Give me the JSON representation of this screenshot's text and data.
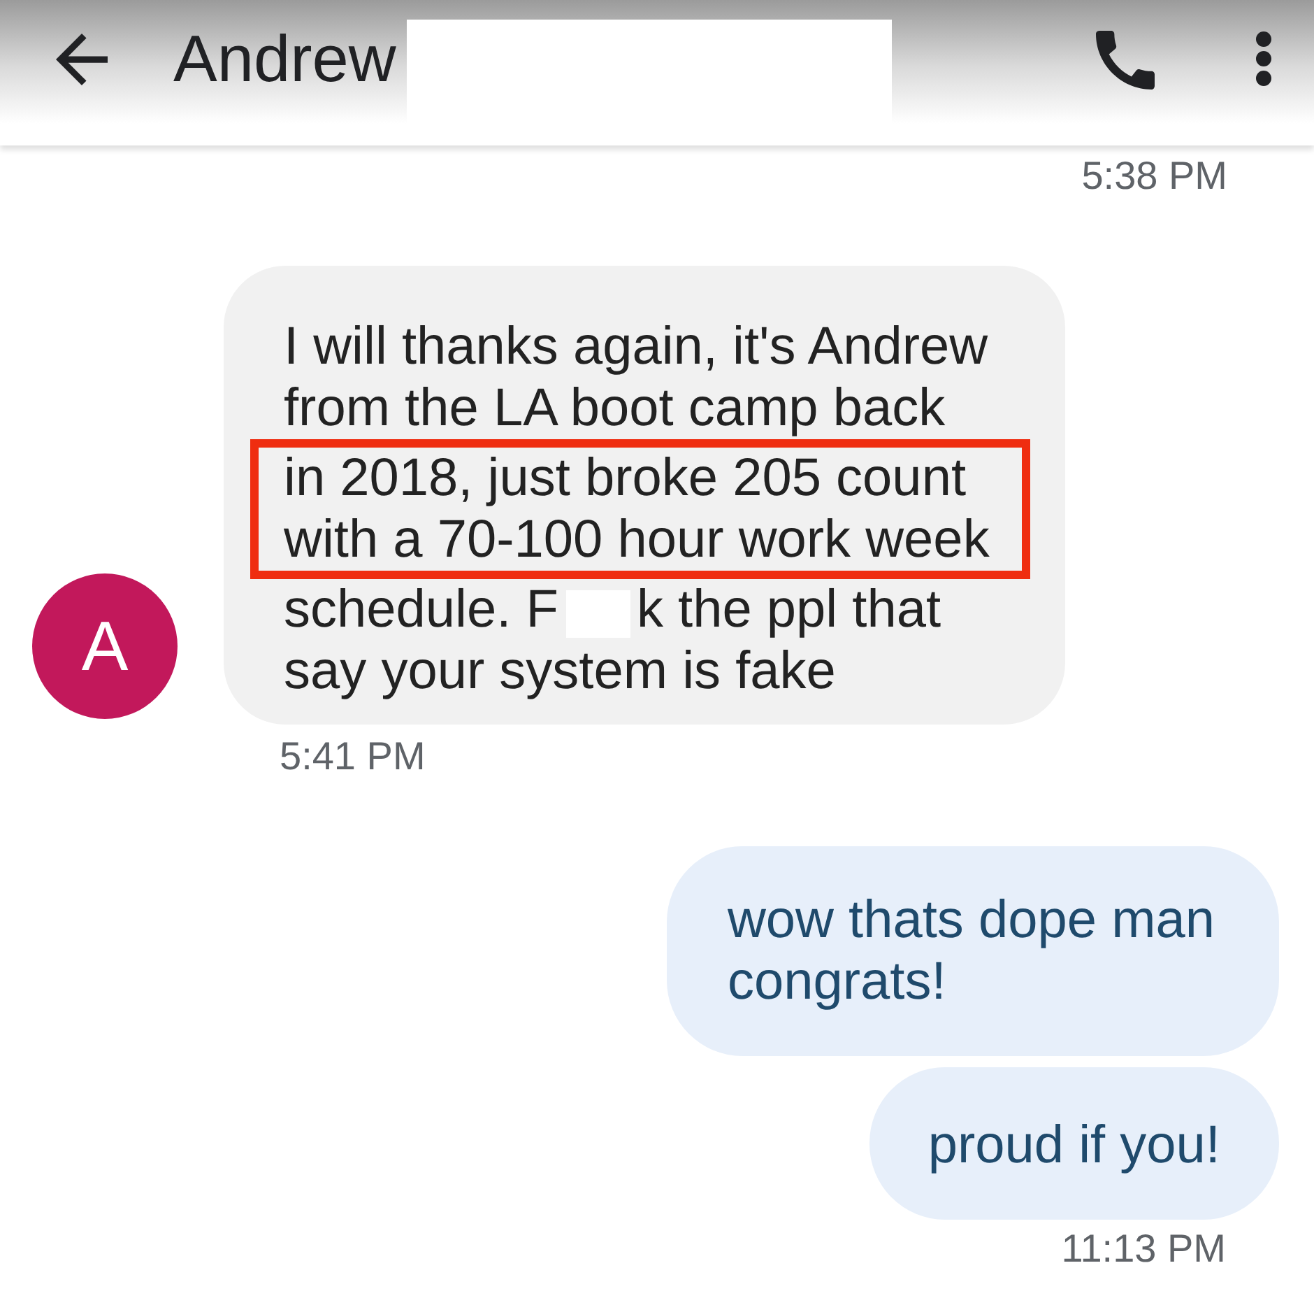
{
  "header": {
    "title": "Andrew",
    "title_redacted": true
  },
  "conversation": [
    {
      "kind": "timestamp",
      "text": "5:38 PM"
    },
    {
      "kind": "incoming",
      "avatar_initial": "A",
      "segments": [
        {
          "lines": [
            [
              "I will thanks again, it's Andrew"
            ],
            [
              "from the LA boot camp back"
            ]
          ],
          "highlighted": false
        },
        {
          "lines": [
            [
              "in 2018, just broke 205 count"
            ],
            [
              "with a 70-100 hour work week"
            ]
          ],
          "highlighted": true
        },
        {
          "lines": [
            [
              "schedule. F",
              "k the ppl that"
            ],
            [
              "say your system is fake"
            ]
          ],
          "highlighted": false
        }
      ],
      "time": "5:41 PM"
    },
    {
      "kind": "outgoing",
      "segments": [
        {
          "lines": [
            [
              "wow thats dope man"
            ],
            [
              "congrats!"
            ]
          ],
          "highlighted": false
        }
      ]
    },
    {
      "kind": "outgoing",
      "segments": [
        {
          "lines": [
            [
              "proud if you!"
            ]
          ],
          "highlighted": false
        }
      ],
      "time": "11:13 PM"
    }
  ]
}
